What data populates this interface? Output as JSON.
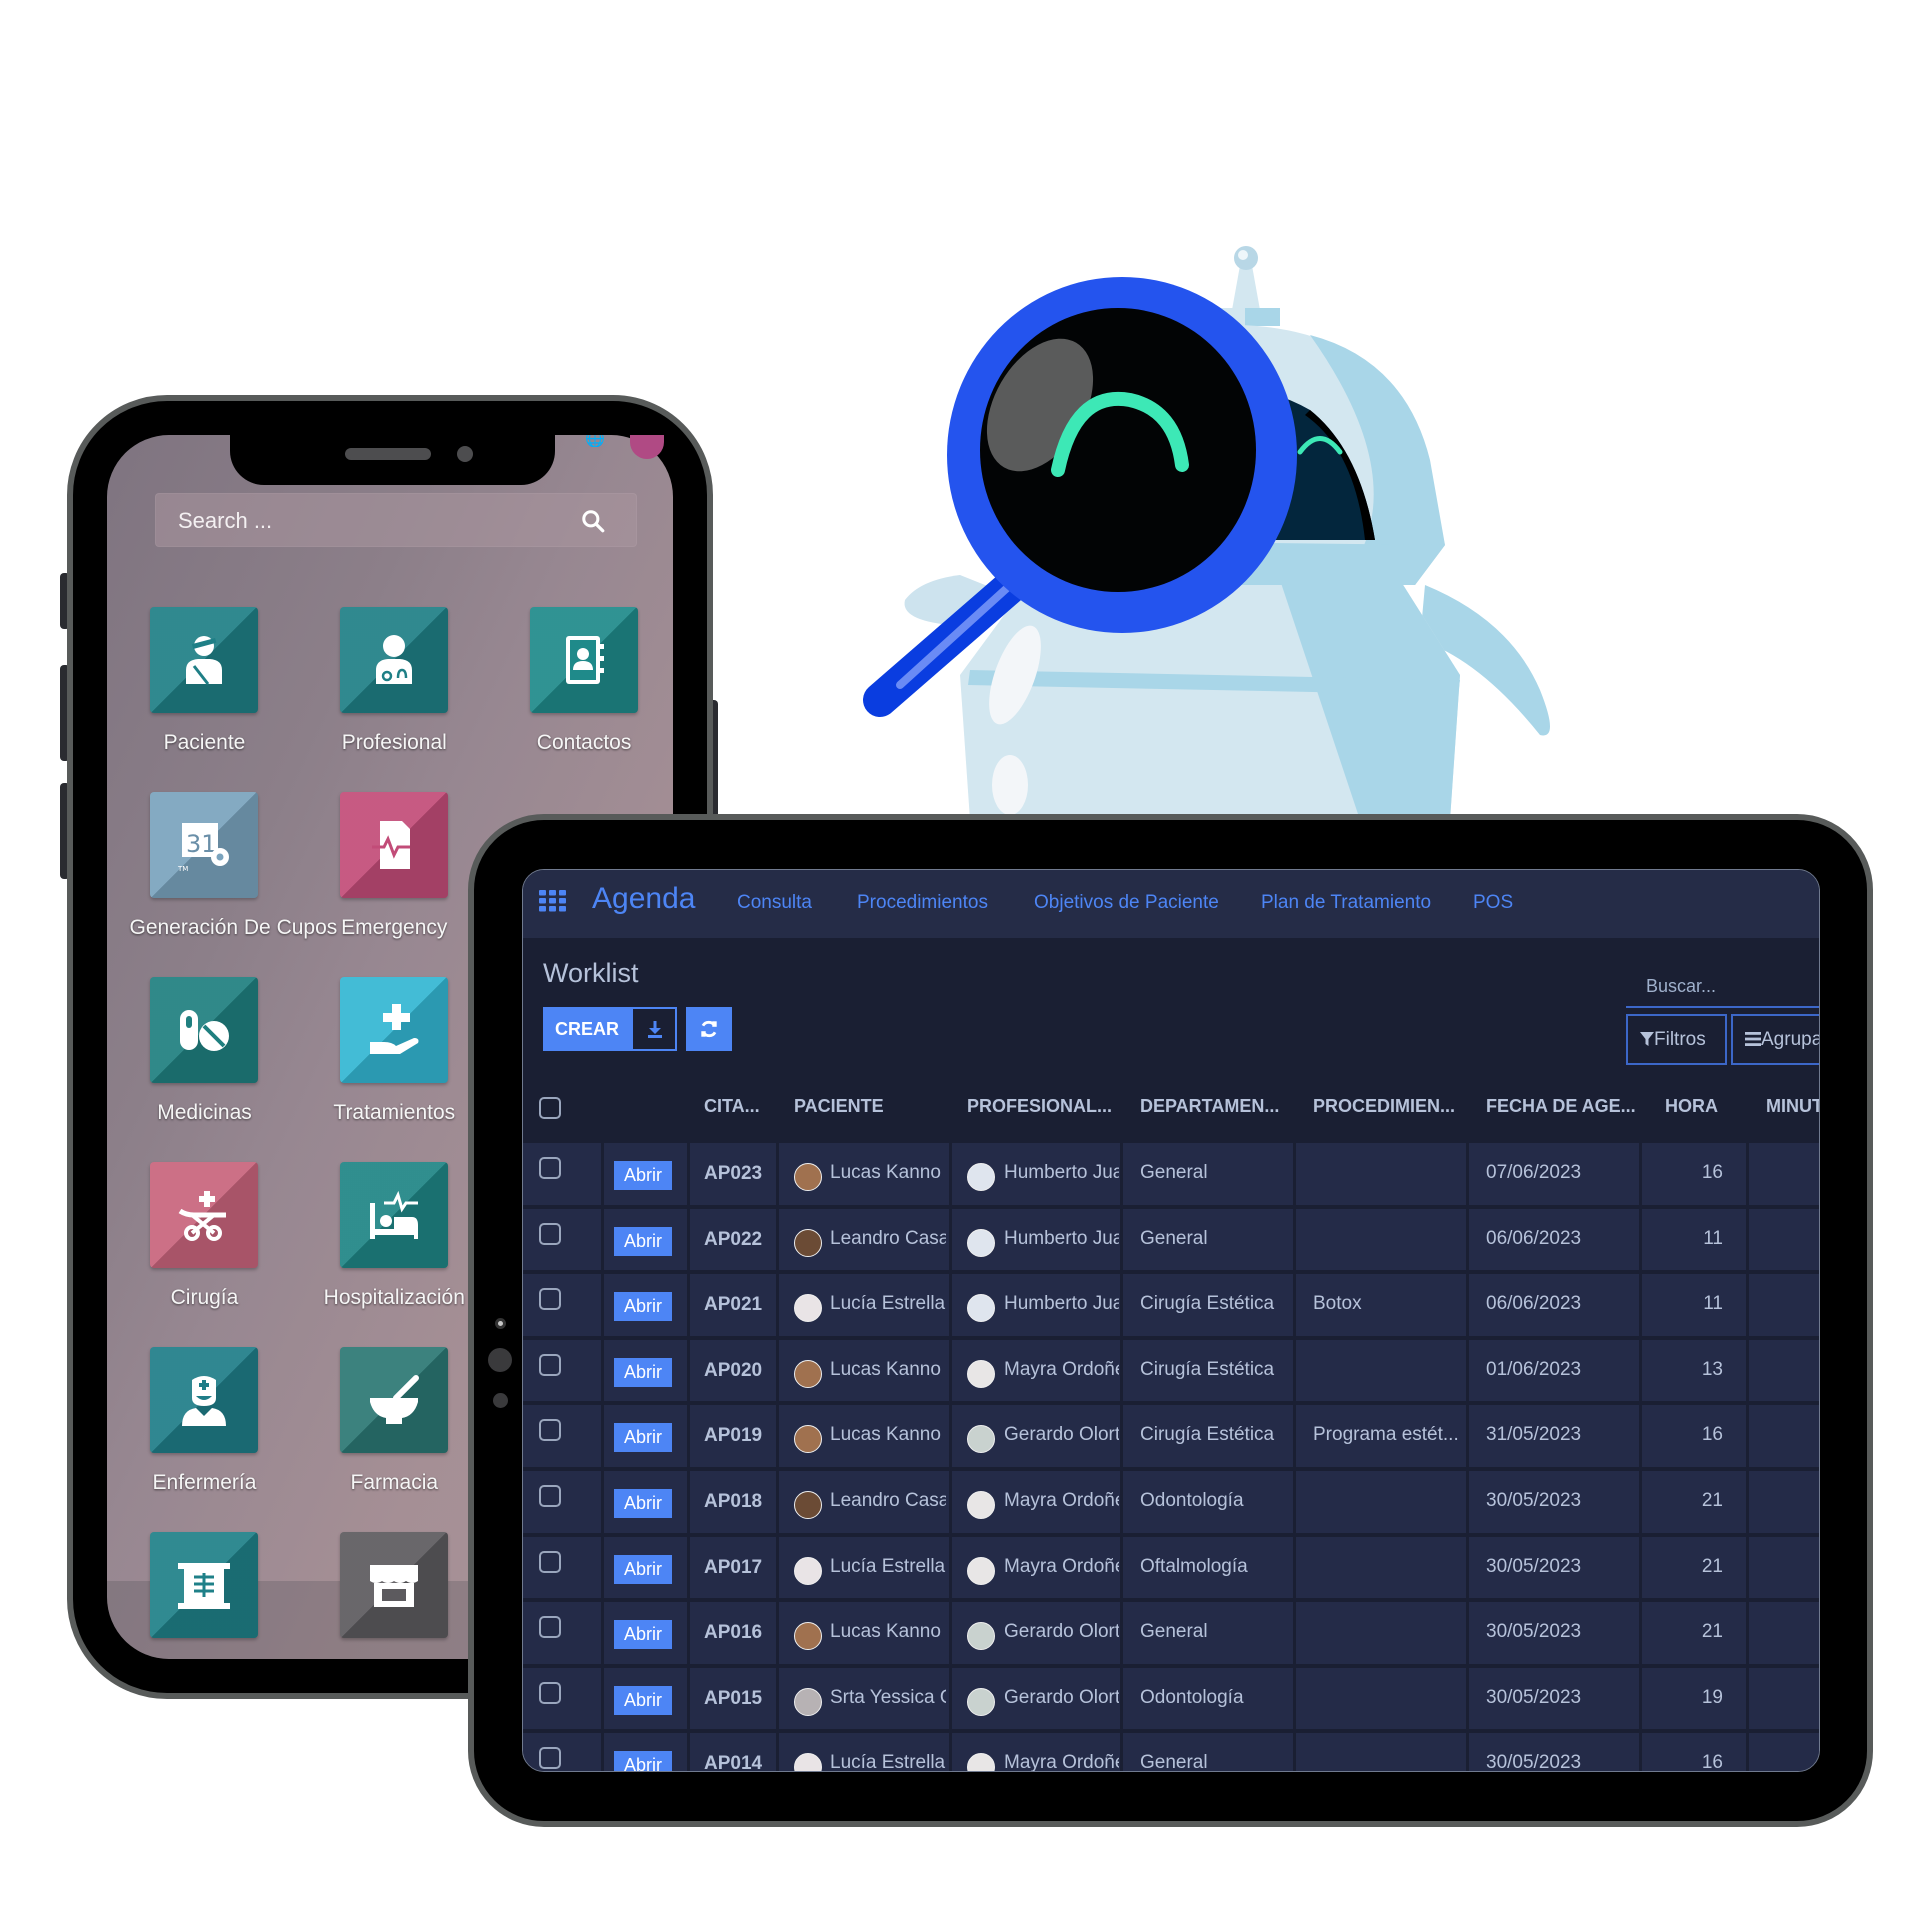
{
  "phone": {
    "search_placeholder": "Search ...",
    "apps": [
      {
        "label": "Paciente",
        "icon": "injured-patient-icon",
        "color": "#1f7f86"
      },
      {
        "label": "Profesional",
        "icon": "doctor-icon",
        "color": "#1f7f86"
      },
      {
        "label": "Contactos",
        "icon": "address-book-icon",
        "color": "#1f8a8a"
      },
      {
        "label": "Generación De Cupos",
        "icon": "calendar-gear-icon",
        "color": "#7aa3bd"
      },
      {
        "label": "Emergency",
        "icon": "medical-report-icon",
        "color": "#c24c78"
      },
      {
        "label": "Medicinas",
        "icon": "pills-icon",
        "color": "#1f7f7f"
      },
      {
        "label": "Tratamientos",
        "icon": "hand-cross-icon",
        "color": "#33b6d3"
      },
      {
        "label": "Cirugía",
        "icon": "stretcher-icon",
        "color": "#c8647c"
      },
      {
        "label": "Hospitalización",
        "icon": "hospital-bed-icon",
        "color": "#1f8585"
      },
      {
        "label": "Enfermería",
        "icon": "nurse-icon",
        "color": "#1f7d88"
      },
      {
        "label": "Farmacia",
        "icon": "mortar-pestle-icon",
        "color": "#2b7773"
      },
      {
        "label": "",
        "icon": "xray-icon",
        "color": "#1f8088"
      },
      {
        "label": "",
        "icon": "store-icon",
        "color": "#5c5a5e"
      }
    ]
  },
  "tablet": {
    "app_name": "Agenda",
    "nav": [
      "Consulta",
      "Procedimientos",
      "Objetivos de Paciente",
      "Plan de Tratamiento",
      "POS"
    ],
    "page_title": "Worklist",
    "create_label": "CREAR",
    "search_placeholder": "Buscar...",
    "filters_label": "Filtros",
    "group_label": "Agrupar",
    "colors": {
      "accent": "#4d85f5",
      "bg": "#1a1f33",
      "row": "#242b48"
    },
    "columns": [
      "CITA...",
      "PACIENTE",
      "PROFESIONAL...",
      "DEPARTAMEN...",
      "PROCEDIMIEN...",
      "FECHA DE AGE...",
      "HORA",
      "MINUTO"
    ],
    "open_label": "Abrir",
    "rows": [
      {
        "cita": "AP023",
        "paciente": "Lucas Kanno",
        "profesional": "Humberto Juarez",
        "departamento": "General",
        "procedimiento": "",
        "fecha": "07/06/2023",
        "hora": "16"
      },
      {
        "cita": "AP022",
        "paciente": "Leandro Casares",
        "profesional": "Humberto Juarez",
        "departamento": "General",
        "procedimiento": "",
        "fecha": "06/06/2023",
        "hora": "11"
      },
      {
        "cita": "AP021",
        "paciente": "Lucía Estrella",
        "profesional": "Humberto Juarez",
        "departamento": "Cirugía Estética",
        "procedimiento": "Botox",
        "fecha": "06/06/2023",
        "hora": "11"
      },
      {
        "cita": "AP020",
        "paciente": "Lucas Kanno",
        "profesional": "Mayra Ordoñez",
        "departamento": "Cirugía Estética",
        "procedimiento": "",
        "fecha": "01/06/2023",
        "hora": "13"
      },
      {
        "cita": "AP019",
        "paciente": "Lucas Kanno",
        "profesional": "Gerardo Olortegui",
        "departamento": "Cirugía Estética",
        "procedimiento": "Programa estét...",
        "fecha": "31/05/2023",
        "hora": "16"
      },
      {
        "cita": "AP018",
        "paciente": "Leandro Casares",
        "profesional": "Mayra Ordoñez",
        "departamento": "Odontología",
        "procedimiento": "",
        "fecha": "30/05/2023",
        "hora": "21"
      },
      {
        "cita": "AP017",
        "paciente": "Lucía Estrella",
        "profesional": "Mayra Ordoñez",
        "departamento": "Oftalmología",
        "procedimiento": "",
        "fecha": "30/05/2023",
        "hora": "21"
      },
      {
        "cita": "AP016",
        "paciente": "Lucas Kanno",
        "profesional": "Gerardo Olortegui",
        "departamento": "General",
        "procedimiento": "",
        "fecha": "30/05/2023",
        "hora": "21"
      },
      {
        "cita": "AP015",
        "paciente": "Srta Yessica O",
        "profesional": "Gerardo Olortegui",
        "departamento": "Odontología",
        "procedimiento": "",
        "fecha": "30/05/2023",
        "hora": "19"
      },
      {
        "cita": "AP014",
        "paciente": "Lucía Estrella",
        "profesional": "Mayra Ordoñez",
        "departamento": "General",
        "procedimiento": "",
        "fecha": "30/05/2023",
        "hora": "16"
      }
    ]
  }
}
